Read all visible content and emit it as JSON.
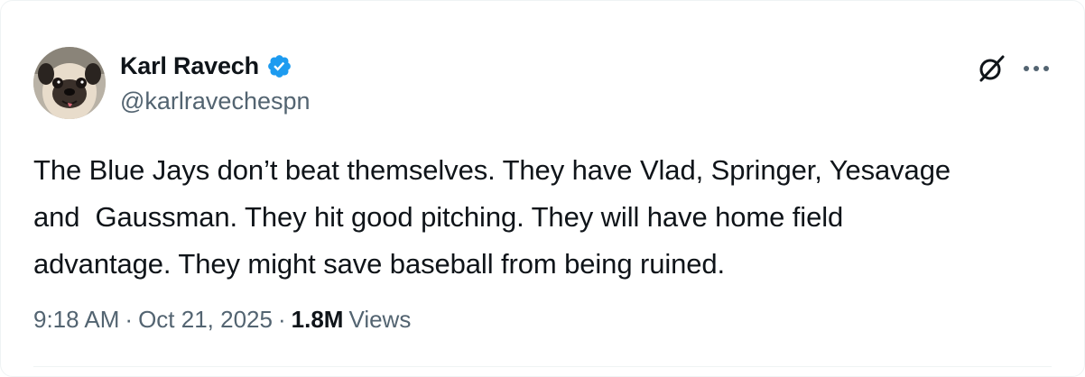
{
  "author": {
    "display_name": "Karl Ravech",
    "handle": "@karlravechespn",
    "verified": true,
    "avatar_icon": "pug-avatar"
  },
  "tweet": {
    "text": "The Blue Jays don’t beat themselves. They have Vlad, Springer, Yesavage\nand  Gaussman. They hit good pitching. They will have home field\nadvantage. They might save baseball from being ruined."
  },
  "meta": {
    "time": "9:18 AM",
    "separator": "·",
    "date": "Oct 21, 2025",
    "views_count": "1.8M",
    "views_label": "Views"
  },
  "icons": {
    "verified": "verified-badge-icon",
    "grok": "grok-icon",
    "more": "more-options-icon"
  },
  "colors": {
    "verified_blue": "#1d9bf0",
    "text_primary": "#0f1419",
    "text_secondary": "#536471",
    "border": "#eff3f4"
  }
}
